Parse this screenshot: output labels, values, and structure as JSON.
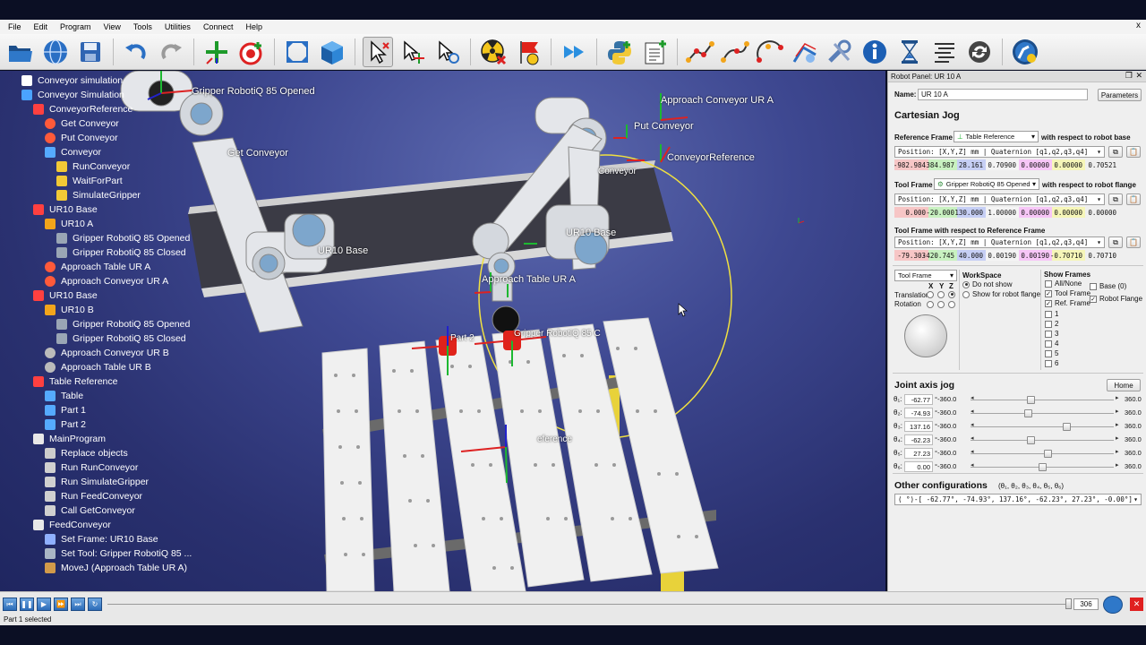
{
  "menu": [
    "File",
    "Edit",
    "Program",
    "View",
    "Tools",
    "Utilities",
    "Connect",
    "Help"
  ],
  "window_close": "x",
  "toolbar_icons": [
    "open-folder-icon",
    "globe-icon",
    "save-icon",
    "undo-icon",
    "redo-icon",
    "add-target-icon",
    "teach-target-icon",
    "fit-all-icon",
    "cube-view-icon",
    "select-icon",
    "move-reference-icon",
    "move-tool-icon",
    "collision-icon",
    "flag-icon",
    "fast-forward-icon",
    "python-icon",
    "new-program-icon",
    "path-icon-1",
    "path-icon-2",
    "path-icon-3",
    "curve-follow-icon",
    "tools-icon",
    "info-icon",
    "hourglass-icon",
    "list-icon",
    "sync-icon",
    "robot-connect-icon"
  ],
  "tree": [
    {
      "label": "Conveyor simulation",
      "indent": 0,
      "icon": "document-icon"
    },
    {
      "label": "Conveyor Simulation",
      "indent": 0,
      "icon": "station-icon"
    },
    {
      "label": "ConveyorReference",
      "indent": 1,
      "icon": "frame-icon"
    },
    {
      "label": "Get Conveyor",
      "indent": 2,
      "icon": "target-icon"
    },
    {
      "label": "Put Conveyor",
      "indent": 2,
      "icon": "target-icon"
    },
    {
      "label": "Conveyor",
      "indent": 2,
      "icon": "object-icon"
    },
    {
      "label": "RunConveyor",
      "indent": 3,
      "icon": "python-script-icon"
    },
    {
      "label": "WaitForPart",
      "indent": 3,
      "icon": "python-script-icon"
    },
    {
      "label": "SimulateGripper",
      "indent": 3,
      "icon": "python-script-icon"
    },
    {
      "label": "UR10 Base",
      "indent": 1,
      "icon": "frame-icon"
    },
    {
      "label": "UR10 A",
      "indent": 2,
      "icon": "robot-icon"
    },
    {
      "label": "Gripper RobotiQ 85 Opened",
      "indent": 3,
      "icon": "gripper-icon"
    },
    {
      "label": "Gripper RobotiQ 85 Closed",
      "indent": 3,
      "icon": "gripper-icon"
    },
    {
      "label": "Approach Table UR A",
      "indent": 2,
      "icon": "target-icon"
    },
    {
      "label": "Approach Conveyor UR A",
      "indent": 2,
      "icon": "target-icon"
    },
    {
      "label": "UR10 Base",
      "indent": 1,
      "icon": "frame-icon"
    },
    {
      "label": "UR10 B",
      "indent": 2,
      "icon": "robot-icon"
    },
    {
      "label": "Gripper RobotiQ 85 Opened",
      "indent": 3,
      "icon": "gripper-icon"
    },
    {
      "label": "Gripper RobotiQ 85 Closed",
      "indent": 3,
      "icon": "gripper-icon"
    },
    {
      "label": "Approach Conveyor UR B",
      "indent": 2,
      "icon": "target-grey-icon"
    },
    {
      "label": "Approach Table UR B",
      "indent": 2,
      "icon": "target-grey-icon"
    },
    {
      "label": "Table Reference",
      "indent": 1,
      "icon": "frame-icon"
    },
    {
      "label": "Table",
      "indent": 2,
      "icon": "object-icon"
    },
    {
      "label": "Part 1",
      "indent": 2,
      "icon": "object-icon"
    },
    {
      "label": "Part 2",
      "indent": 2,
      "icon": "object-icon"
    },
    {
      "label": "MainProgram",
      "indent": 1,
      "icon": "program-icon"
    },
    {
      "label": "Replace objects",
      "indent": 2,
      "icon": "replace-icon"
    },
    {
      "label": "Run RunConveyor",
      "indent": 2,
      "icon": "run-program-icon"
    },
    {
      "label": "Run SimulateGripper",
      "indent": 2,
      "icon": "run-program-icon"
    },
    {
      "label": "Run FeedConveyor",
      "indent": 2,
      "icon": "run-program-icon"
    },
    {
      "label": "Call GetConveyor",
      "indent": 2,
      "icon": "run-program-icon"
    },
    {
      "label": "FeedConveyor",
      "indent": 1,
      "icon": "program-icon"
    },
    {
      "label": "Set Frame: UR10 Base",
      "indent": 2,
      "icon": "set-frame-icon"
    },
    {
      "label": "Set Tool: Gripper RobotiQ 85 ...",
      "indent": 2,
      "icon": "set-tool-icon"
    },
    {
      "label": "MoveJ (Approach Table UR A)",
      "indent": 2,
      "icon": "movej-icon"
    }
  ],
  "viewport_labels": {
    "gripper_opened": "Gripper RobotiQ 85 Opened",
    "get_conveyor": "Get Conveyor",
    "approach_conveyor": "Approach Conveyor UR A",
    "put_conveyor": "Put Conveyor",
    "conveyor_reference": "ConveyorReference",
    "conveyor": "Conveyor",
    "ur10_base_left": "UR10 Base",
    "ur10_base_right": "UR10 Base",
    "approach_table": "Approach Table UR A",
    "part2": "Part 2",
    "gripper_lbl": "Gripper RobotiQ 85 C",
    "reference": "eference"
  },
  "panel": {
    "title": "Robot Panel: UR 10 A",
    "name_label": "Name:",
    "name_value": "UR 10 A",
    "parameters_btn": "Parameters",
    "cartesian_jog": "Cartesian Jog",
    "ref_frame_label": "Reference Frame",
    "ref_frame_value": "Table Reference",
    "ref_frame_suffix": "with respect to robot base",
    "position_combo": "Position: [X,Y,Z] mm | Quaternion [q1,q2,q3,q4]",
    "ref_values": [
      "-982.984",
      "384.987",
      "28.161",
      "0.70900",
      "0.00000",
      "0.00000",
      "0.70521"
    ],
    "tool_frame_label": "Tool Frame",
    "tool_frame_value": "Gripper RobotiQ 85 Opened",
    "tool_frame_suffix": "with respect to robot flange",
    "tool_values": [
      "0.000",
      "-20.000",
      "130.000",
      "1.00000",
      "0.00000",
      "0.00000",
      "0.00000"
    ],
    "tool_wrt_ref_label": "Tool Frame with respect to Reference Frame",
    "tool_ref_values": [
      "-79.303",
      "-420.745",
      "40.000",
      "0.00190",
      "0.00190",
      "-0.70710",
      "0.70710"
    ],
    "tool_frame_combo": "Tool Frame",
    "xyz": [
      "X",
      "Y",
      "Z"
    ],
    "translation": "Translation",
    "rotation": "Rotation",
    "workspace_title": "WorkSpace",
    "ws_do_not_show": "Do not show",
    "ws_show_flange": "Show for robot flange",
    "show_frames_title": "Show Frames",
    "sf_all_none": "All/None",
    "sf_tool_frame": "Tool Frame",
    "sf_ref_frame": "Ref. Frame",
    "sf_base": "Base (0)",
    "sf_robot_flange": "Robot Flange",
    "sf_numbers": [
      "1",
      "2",
      "3",
      "4",
      "5",
      "6"
    ],
    "joint_axis_jog": "Joint axis jog",
    "home_btn": "Home",
    "joints": [
      {
        "label": "θ₁:",
        "value": "-62.77",
        "min": "°-360.0",
        "max": "360.0",
        "fraction": 0.42
      },
      {
        "label": "θ₂:",
        "value": "-74.93",
        "min": "°-360.0",
        "max": "360.0",
        "fraction": 0.4
      },
      {
        "label": "θ₃:",
        "value": "137.16",
        "min": "°-360.0",
        "max": "360.0",
        "fraction": 0.67
      },
      {
        "label": "θ₄:",
        "value": "-62.23",
        "min": "°-360.0",
        "max": "360.0",
        "fraction": 0.42
      },
      {
        "label": "θ₅:",
        "value": "27.23",
        "min": "°-360.0",
        "max": "360.0",
        "fraction": 0.54
      },
      {
        "label": "θ₆:",
        "value": "0.00",
        "min": "°-360.0",
        "max": "360.0",
        "fraction": 0.5
      }
    ],
    "other_configs": "Other configurations",
    "other_configs_sub": "(θ₁, θ₂, θ₃, θ₄, θ₅, θ₆)",
    "configs_value": "( °)-[ -62.77°,  -74.93°,  137.16°,  -62.23°,   27.23°,   -0.00°]"
  },
  "bottom": {
    "frame_value": "306"
  },
  "status": "Part 1 selected",
  "colors": {
    "x_cell": "#f7c6c6",
    "y_cell": "#c8f1c0",
    "z_cell": "#c6cff5",
    "q1_cell": "#f4f4f4",
    "q2_cell": "#f7c6f7",
    "q3_cell": "#f6f6b8"
  }
}
